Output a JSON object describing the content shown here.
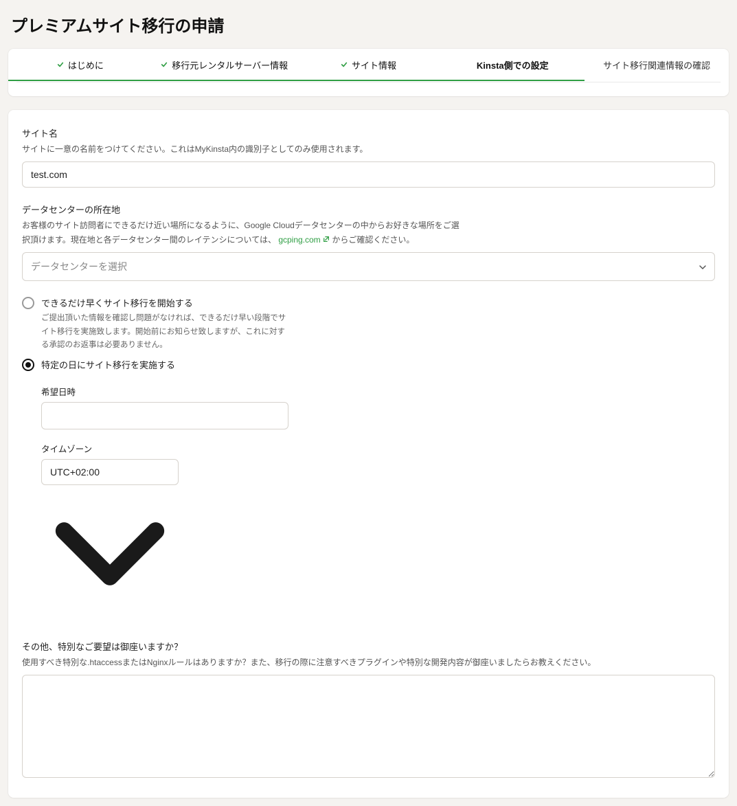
{
  "page": {
    "title": "プレミアムサイト移行の申請"
  },
  "tabs": [
    {
      "label": "はじめに",
      "state": "completed"
    },
    {
      "label": "移行元レンタルサーバー情報",
      "state": "completed"
    },
    {
      "label": "サイト情報",
      "state": "completed"
    },
    {
      "label": "Kinsta側での設定",
      "state": "active"
    },
    {
      "label": "サイト移行関連情報の確認",
      "state": "upcoming"
    }
  ],
  "siteName": {
    "label": "サイト名",
    "help": "サイトに一意の名前をつけてください。これはMyKinsta内の識別子としてのみ使用されます。",
    "value": "test.com"
  },
  "dataCenter": {
    "label": "データセンターの所在地",
    "help_before_link": "お客様のサイト訪問者にできるだけ近い場所になるように、Google Cloudデータセンターの中からお好きな場所をご選択頂けます。現在地と各データセンター間のレイテンシについては、",
    "link_text": "gcping.com",
    "help_after_link": "からご確認ください。",
    "placeholder": "データセンターを選択"
  },
  "schedule": {
    "option_asap": {
      "title": "できるだけ早くサイト移行を開始する",
      "desc": "ご提出頂いた情報を確認し問題がなければ、できるだけ早い段階でサイト移行を実施致します。開始前にお知らせ致しますが、これに対する承認のお返事は必要ありません。"
    },
    "option_date": {
      "title": "特定の日にサイト移行を実施する"
    },
    "preferred_date": {
      "label": "希望日時",
      "value": ""
    },
    "timezone": {
      "label": "タイムゾーン",
      "value": "UTC+02:00"
    }
  },
  "specialRequest": {
    "label": "その他、特別なご要望は御座いますか？",
    "help": "使用すべき特別な.htaccessまたはNginxルールはありますか？また、移行の際に注意すべきプラグインや特別な開発内容が御座いましたらお教えください。",
    "value": ""
  }
}
